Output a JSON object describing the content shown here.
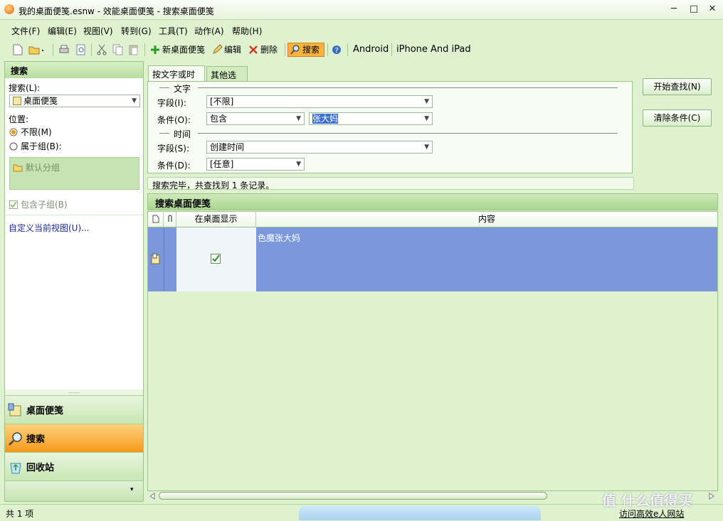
{
  "window": {
    "title": "我的桌面便笺.esnw - 效能桌面便笺 - 搜索桌面便笺",
    "minimize": "─",
    "maximize": "□",
    "close": "✕"
  },
  "menu": [
    "文件(F)",
    "编辑(E)",
    "视图(V)",
    "转到(G)",
    "工具(T)",
    "动作(A)",
    "帮助(H)"
  ],
  "toolbar": {
    "new_note": "新桌面便笺",
    "edit": "编辑",
    "delete": "删除",
    "search": "搜索",
    "android": "Android",
    "iphone": "iPhone And iPad"
  },
  "left": {
    "header": "搜索",
    "search_label": "搜索(L):",
    "search_value": "桌面便笺",
    "position_label": "位置:",
    "radio_all": "不限(M)",
    "radio_group": "属于组(B):",
    "default_group": "默认分组",
    "include_sub": "包含子组(B)",
    "customize": "自定义当前视图(U)...",
    "nav": [
      {
        "label": "桌面便笺"
      },
      {
        "label": "搜索"
      },
      {
        "label": "回收站"
      }
    ],
    "splitter": "......",
    "nav_more": "▾"
  },
  "form": {
    "tab_text_time": "按文字或时间",
    "tab_other": "其他选项",
    "section_text": "文字",
    "section_time": "时间",
    "field_label": "字段(I):",
    "field_value": "[不限]",
    "cond_label": "条件(O):",
    "cond_value": "包含",
    "keyword": "张大妈",
    "time_field_label": "字段(S):",
    "time_field_value": "创建时间",
    "time_cond_label": "条件(D):",
    "time_cond_value": "[任意]",
    "start_button": "开始查找(N)",
    "clear_button": "清除条件(C)",
    "status": "搜索完毕，共查找到 1 条记录。"
  },
  "results": {
    "header": "搜索桌面便笺",
    "columns": [
      "在桌面显示",
      "内容"
    ],
    "rows": [
      {
        "content": "色魔张大妈"
      }
    ]
  },
  "statusbar": {
    "count": "共 1 项",
    "link": "访问高效e人网站"
  },
  "watermark": "值 什么值得买"
}
